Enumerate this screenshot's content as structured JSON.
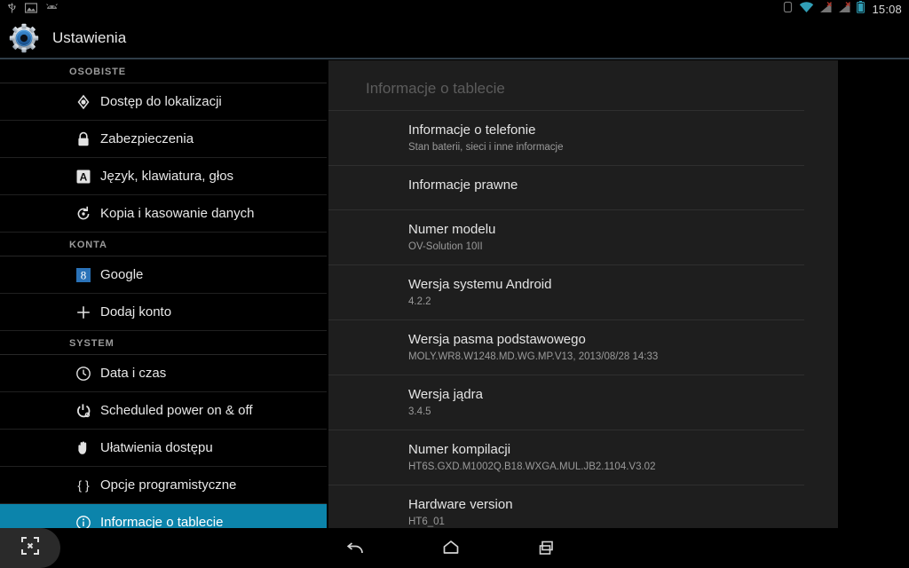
{
  "status_bar": {
    "left_icons": [
      "usb-icon",
      "screenshot-image-icon",
      "usb-debug-icon"
    ],
    "right_icons": [
      "rotation-lock-icon",
      "wifi-icon",
      "signal-sim1-no-service-icon",
      "signal-sim2-no-service-icon",
      "battery-icon"
    ],
    "time": "15:08"
  },
  "title_bar": {
    "icon": "settings-gear-icon",
    "title": "Ustawienia"
  },
  "sidebar": {
    "sections": [
      {
        "header": "OSOBISTE",
        "items": [
          {
            "label": "Dostęp do lokalizacji",
            "icon": "location-icon",
            "selected": false
          },
          {
            "label": "Zabezpieczenia",
            "icon": "lock-icon",
            "selected": false
          },
          {
            "label": "Język, klawiatura, głos",
            "icon": "language-a-icon",
            "selected": false
          },
          {
            "label": "Kopia i kasowanie danych",
            "icon": "backup-restore-icon",
            "selected": false
          }
        ]
      },
      {
        "header": "KONTA",
        "items": [
          {
            "label": "Google",
            "icon": "google-account-icon",
            "selected": false
          },
          {
            "label": "Dodaj konto",
            "icon": "plus-icon",
            "selected": false
          }
        ]
      },
      {
        "header": "SYSTEM",
        "items": [
          {
            "label": "Data i czas",
            "icon": "clock-icon",
            "selected": false
          },
          {
            "label": "Scheduled power on & off",
            "icon": "power-icon",
            "selected": false
          },
          {
            "label": "Ułatwienia dostępu",
            "icon": "hand-icon",
            "selected": false
          },
          {
            "label": "Opcje programistyczne",
            "icon": "braces-icon",
            "selected": false
          },
          {
            "label": "Informacje o tablecie",
            "icon": "info-circle-icon",
            "selected": true
          }
        ]
      }
    ]
  },
  "content": {
    "title": "Informacje o tablecie",
    "entries": [
      {
        "title": "Informacje o telefonie",
        "sub": "Stan baterii, sieci i inne informacje"
      },
      {
        "title": "Informacje prawne",
        "sub": ""
      },
      {
        "title": "Numer modelu",
        "sub": "OV-Solution 10II"
      },
      {
        "title": "Wersja systemu Android",
        "sub": "4.2.2"
      },
      {
        "title": "Wersja pasma podstawowego",
        "sub": "MOLY.WR8.W1248.MD.WG.MP.V13, 2013/08/28 14:33"
      },
      {
        "title": "Wersja jądra",
        "sub": "3.4.5"
      },
      {
        "title": "Numer kompilacji",
        "sub": "HT6S.GXD.M1002Q.B18.WXGA.MUL.JB2.1104.V3.02"
      },
      {
        "title": "Hardware version",
        "sub": "HT6_01"
      }
    ]
  },
  "nav_bar": {
    "screenshot_label": "screenshot-icon",
    "buttons": [
      {
        "name": "back-button"
      },
      {
        "name": "home-button"
      },
      {
        "name": "recents-button"
      }
    ]
  },
  "colors": {
    "accent_selected": "#0c84ab",
    "panel_bg": "#1e1e1e",
    "page_bg": "#000000",
    "divider": "#2f2f2f"
  }
}
